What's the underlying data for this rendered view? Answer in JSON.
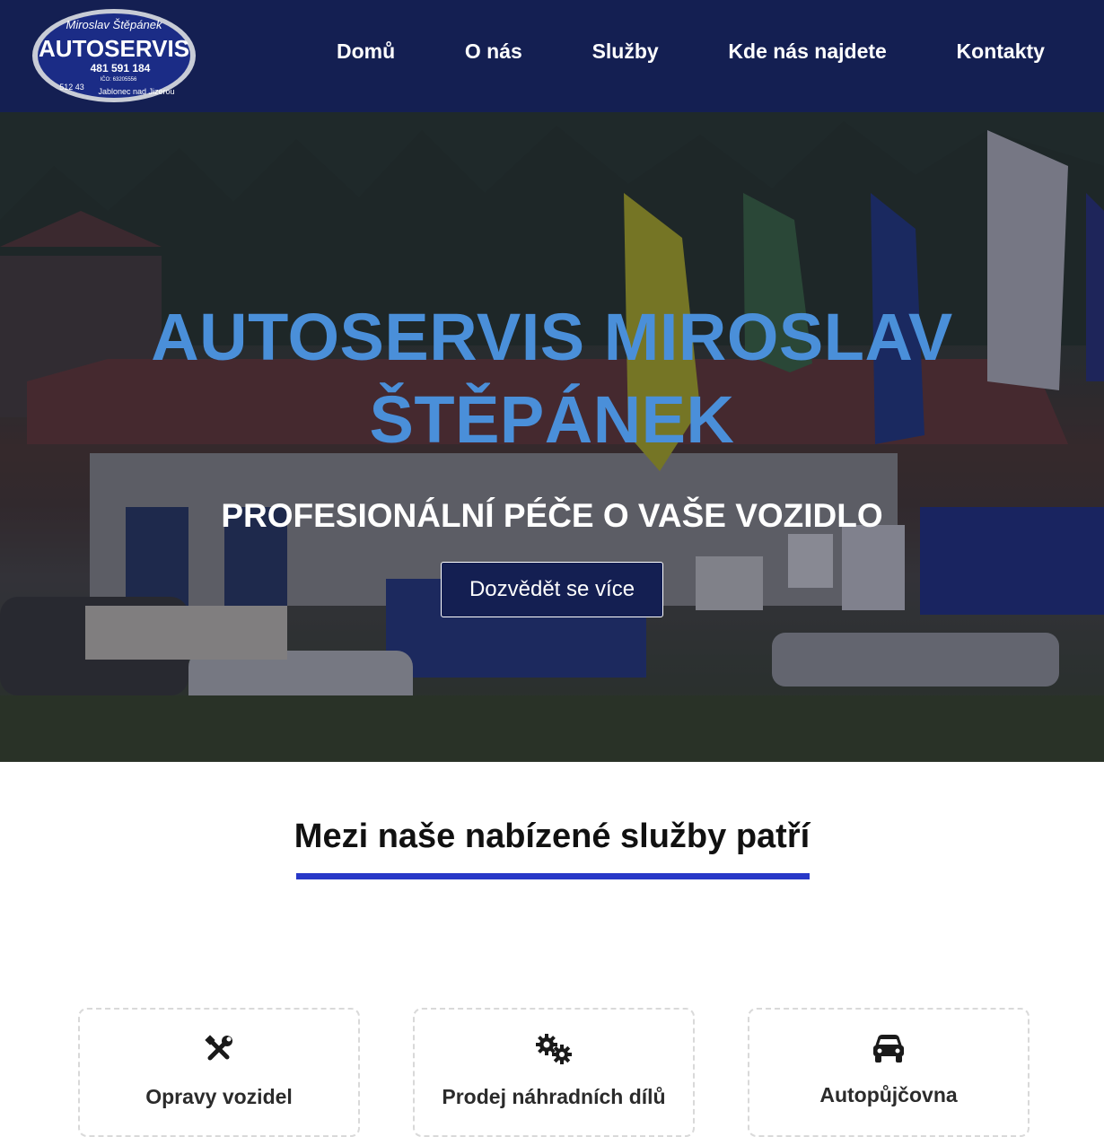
{
  "header": {
    "logo": {
      "owner": "Miroslav Štěpánek",
      "brand": "AUTOSERVIS",
      "phone": "481 591 184",
      "ico": "IČO: 63205556",
      "postcode": "512 43",
      "town": "Jablonec nad Jizerou"
    },
    "nav": [
      {
        "label": "Domů",
        "icon": "none"
      },
      {
        "label": "O nás",
        "icon": "none"
      },
      {
        "label": "Služby",
        "icon": "none"
      },
      {
        "label": "Kde nás najdete",
        "icon": "none"
      },
      {
        "label": "Kontakty",
        "icon": "none"
      }
    ]
  },
  "hero": {
    "title": "AUTOSERVIS MIROSLAV ŠTĚPÁNEK",
    "subtitle": "PROFESIONÁLNÍ PÉČE O VAŠE VOZIDLO",
    "button_label": "Dozvědět se více"
  },
  "services": {
    "title": "Mezi naše nabízené služby patří",
    "items": [
      {
        "label": "Opravy vozidel",
        "icon": "tools-icon"
      },
      {
        "label": "Prodej náhradních dílů",
        "icon": "gears-icon"
      },
      {
        "label": "Autopůjčovna",
        "icon": "car-icon"
      }
    ]
  },
  "colors": {
    "header_bg": "#141f52",
    "hero_title": "#4a8fd9",
    "accent_underline": "#2838c8"
  }
}
